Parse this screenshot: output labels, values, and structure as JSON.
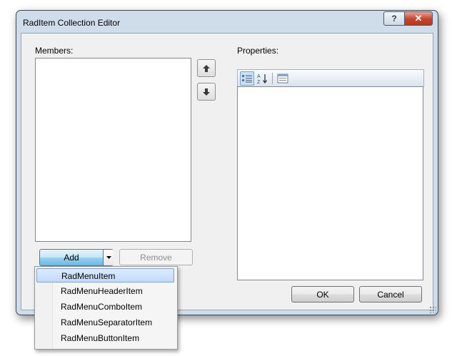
{
  "window": {
    "title": "RadItem Collection Editor",
    "help_label": "?",
    "close_label": "✕"
  },
  "members": {
    "label": "Members:",
    "items": []
  },
  "properties": {
    "label": "Properties:"
  },
  "buttons": {
    "add": "Add",
    "remove": "Remove",
    "ok": "OK",
    "cancel": "Cancel"
  },
  "add_menu": {
    "items": [
      "RadMenuItem",
      "RadMenuHeaderItem",
      "RadMenuComboItem",
      "RadMenuSeparatorItem",
      "RadMenuButtonItem"
    ],
    "highlighted": "RadMenuItem"
  },
  "icons": {
    "move_up": "arrow-up-icon",
    "move_down": "arrow-down-icon",
    "categorized": "categorized-icon",
    "alphabetical": "alphabetical-icon",
    "property_pages": "property-pages-icon"
  },
  "colors": {
    "accent": "#6fb8e1",
    "menu_highlight": "#c1dbfc",
    "close_red": "#c4432c"
  }
}
